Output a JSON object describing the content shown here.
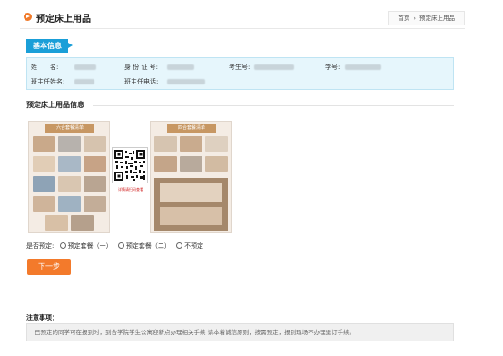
{
  "header": {
    "title": "预定床上用品",
    "breadcrumb": [
      "首页",
      "›",
      "预定床上用品"
    ]
  },
  "basic_info": {
    "tag": "基本信息",
    "fields": {
      "name_label": "姓　　名:",
      "id_label": "身 份 证 号:",
      "exam_no_label": "考生号:",
      "student_no_label": "学号:",
      "teacher_label": "班主任姓名:",
      "teacher_phone_label": "班主任电话:"
    }
  },
  "bedding": {
    "title": "预定床上用品信息",
    "menu1_head": "六合套餐清单",
    "menu2_head": "四合套餐清单",
    "qr_caption": "详情请扫码查看"
  },
  "choice": {
    "label": "是否预定:",
    "options": [
      "预定套餐（一）",
      "预定套餐（二）",
      "不预定"
    ]
  },
  "next_button": "下一步",
  "notes": {
    "title": "注意事项：",
    "text": "已预定的同学可在报到时，到合学院学生公寓迎新点办理相关手续 请本着诚信原则，按需预定，报到现场不办理退订手续。"
  },
  "colors": {
    "accent": "#f37a2b",
    "info_blue": "#1a9fd8",
    "info_bg": "#e6f6fc"
  }
}
